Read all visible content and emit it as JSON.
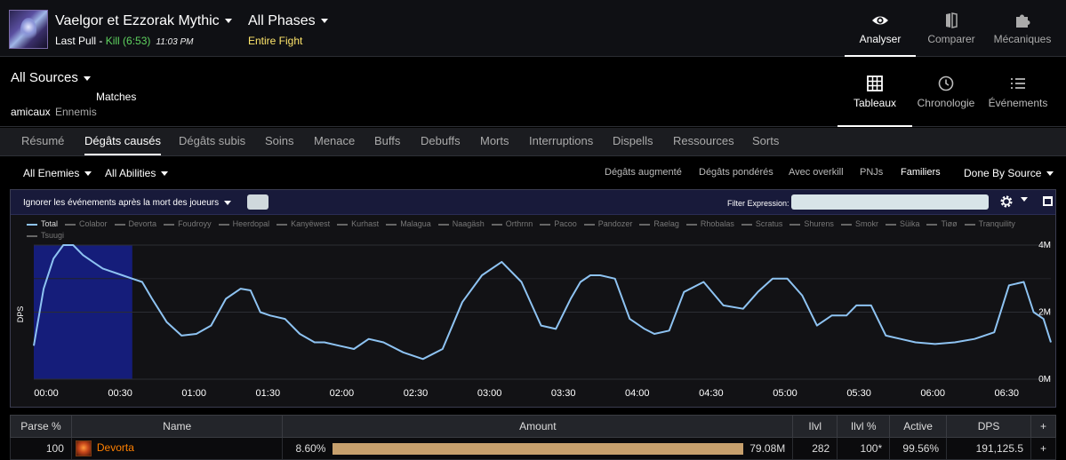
{
  "header": {
    "boss_name": "Vaelgor et Ezzorak Mythic",
    "pull_label": "Last Pull",
    "pull_sep": " - ",
    "pull_result": "Kill (6:53)",
    "pull_time": "11:03 PM",
    "phase": "All Phases",
    "phase_sub": "Entire Fight",
    "nav": [
      {
        "label": "Analyser",
        "icon": "eye-icon"
      },
      {
        "label": "Comparer",
        "icon": "compare-icon"
      },
      {
        "label": "Mécaniques",
        "icon": "puzzle-icon"
      }
    ]
  },
  "sources": {
    "title": "All Sources",
    "matches": "Matches",
    "friendly": "amicaux",
    "enemies": "Ennemis",
    "views": [
      {
        "label": "Tableaux",
        "icon": "grid-icon"
      },
      {
        "label": "Chronologie",
        "icon": "clock-icon"
      },
      {
        "label": "Événements",
        "icon": "list-icon"
      }
    ]
  },
  "tabs": [
    "Résumé",
    "Dégâts causés",
    "Dégâts subis",
    "Soins",
    "Menace",
    "Buffs",
    "Debuffs",
    "Morts",
    "Interruptions",
    "Dispells",
    "Ressources",
    "Sorts"
  ],
  "active_tab": "Dégâts causés",
  "filters": {
    "enemies": "All Enemies",
    "abilities": "All Abilities",
    "options": [
      "Dégâts augmenté",
      "Dégâts pondérés",
      "Avec overkill",
      "PNJs",
      "Familiers"
    ],
    "active_option": "Familiers",
    "done_by": "Done By Source"
  },
  "panel": {
    "ignore_label": "Ignorer les événements après la mort des joueurs",
    "filter_label": "Filter Expression:",
    "filter_value": ""
  },
  "chart_data": {
    "type": "line",
    "ylabel": "DPS",
    "yticks": [
      "0M",
      "2M",
      "4M"
    ],
    "xticks": [
      "00:00",
      "00:30",
      "01:00",
      "01:30",
      "02:00",
      "02:30",
      "03:00",
      "03:30",
      "04:00",
      "04:30",
      "05:00",
      "05:30",
      "06:00",
      "06:30"
    ],
    "x_unit": "seconds",
    "xlim": [
      0,
      413
    ],
    "ylim": [
      0,
      4.0
    ],
    "y_unit": "M",
    "highlight_range_s": [
      0,
      40
    ],
    "legend": [
      "Total",
      "Colabor",
      "Devorta",
      "Foudroyy",
      "Heerdopal",
      "Kanyëwest",
      "Kurhast",
      "Malagua",
      "Naagäsh",
      "Orthrnn",
      "Pacoo",
      "Pandozer",
      "Raelag",
      "Rhobalas",
      "Scratus",
      "Shurens",
      "Smokr",
      "Süika",
      "Tiøø",
      "Tranquility",
      "Tsuugi"
    ],
    "series": [
      {
        "name": "Total",
        "color": "#8ec3f2",
        "x": [
          0,
          4,
          8,
          12,
          16,
          20,
          24,
          28,
          32,
          36,
          40,
          44,
          48,
          54,
          60,
          66,
          72,
          78,
          84,
          88,
          92,
          96,
          102,
          108,
          114,
          118,
          124,
          130,
          136,
          142,
          150,
          158,
          166,
          174,
          182,
          190,
          198,
          206,
          212,
          218,
          222,
          226,
          230,
          236,
          242,
          248,
          252,
          258,
          264,
          272,
          280,
          288,
          294,
          300,
          306,
          312,
          318,
          324,
          330,
          334,
          340,
          346,
          352,
          358,
          366,
          374,
          382,
          390,
          396,
          402,
          406,
          410,
          413
        ],
        "y": [
          1.0,
          2.7,
          3.6,
          4.0,
          4.0,
          3.7,
          3.5,
          3.3,
          3.2,
          3.1,
          3.0,
          2.9,
          2.4,
          1.7,
          1.3,
          1.35,
          1.6,
          2.4,
          2.7,
          2.65,
          2.0,
          1.9,
          1.8,
          1.35,
          1.1,
          1.1,
          1.0,
          0.9,
          1.2,
          1.1,
          0.8,
          0.6,
          0.9,
          2.3,
          3.1,
          3.5,
          2.9,
          1.6,
          1.5,
          2.4,
          2.9,
          3.1,
          3.1,
          3.0,
          1.8,
          1.5,
          1.35,
          1.45,
          2.6,
          2.9,
          2.2,
          2.1,
          2.6,
          3.0,
          3.0,
          2.5,
          1.6,
          1.9,
          1.9,
          2.2,
          2.2,
          1.3,
          1.2,
          1.1,
          1.05,
          1.1,
          1.2,
          1.4,
          2.8,
          2.9,
          2.0,
          1.8,
          1.1
        ]
      }
    ]
  },
  "table": {
    "headers": [
      "Parse %",
      "Name",
      "Amount",
      "Ilvl",
      "Ilvl %",
      "Active",
      "DPS",
      "+"
    ],
    "rows": [
      {
        "parse": "100",
        "name": "Devorta",
        "amount_pct": "8.60%",
        "amount_fill": 1.0,
        "amount": "79.08M",
        "ilvl": "282",
        "ilvl_pct": "100*",
        "active": "99.56%",
        "dps": "191,125.5",
        "plus": "+"
      }
    ]
  }
}
